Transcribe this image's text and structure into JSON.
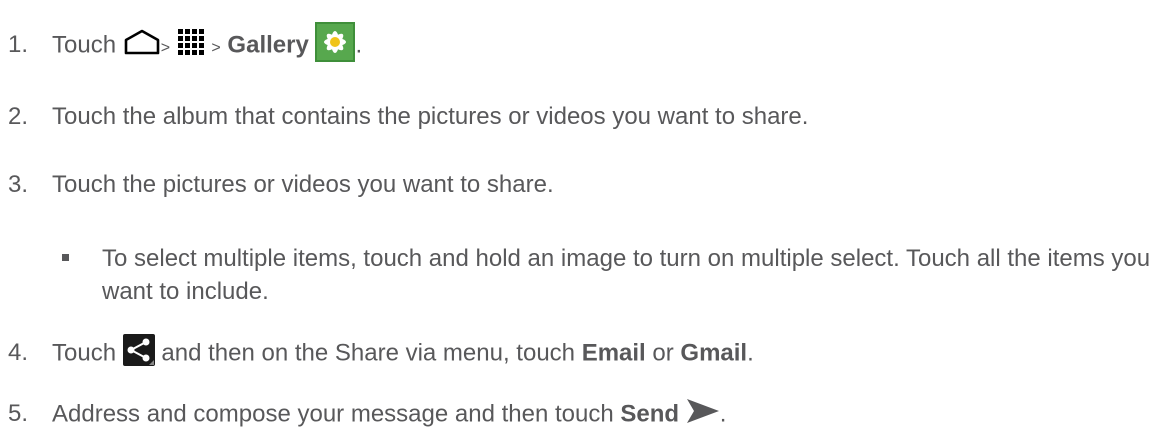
{
  "steps": [
    {
      "number": "1.",
      "text": "Touch",
      "sep1": ">",
      "sep2": ">",
      "bold": "Gallery",
      "end": ".",
      "icons": [
        "home-icon",
        "apps-grid-icon",
        "gallery-app-icon"
      ]
    },
    {
      "number": "2.",
      "text": "Touch the album that contains the pictures or videos you want to share."
    },
    {
      "number": "3.",
      "text": "Touch the pictures or videos you want to share."
    },
    {
      "number": "4.",
      "text_before": "Touch",
      "text_after": "and then on the Share via menu, touch",
      "bold1": "Email",
      "or": "or",
      "bold2": "Gmail",
      "end": ".",
      "icons": [
        "share-icon"
      ]
    },
    {
      "number": "5.",
      "text": "Address and compose your message and then touch",
      "bold": "Send",
      "end": ".",
      "icons": [
        "send-arrow-icon"
      ]
    }
  ],
  "sub_bullet": "To select multiple items, touch and hold an image to turn on multiple select. Touch all the items you want to include.",
  "colors": {
    "text": "#58585a",
    "gallery_green": "#3f8f3a",
    "share_bg": "#1a1a1a"
  }
}
